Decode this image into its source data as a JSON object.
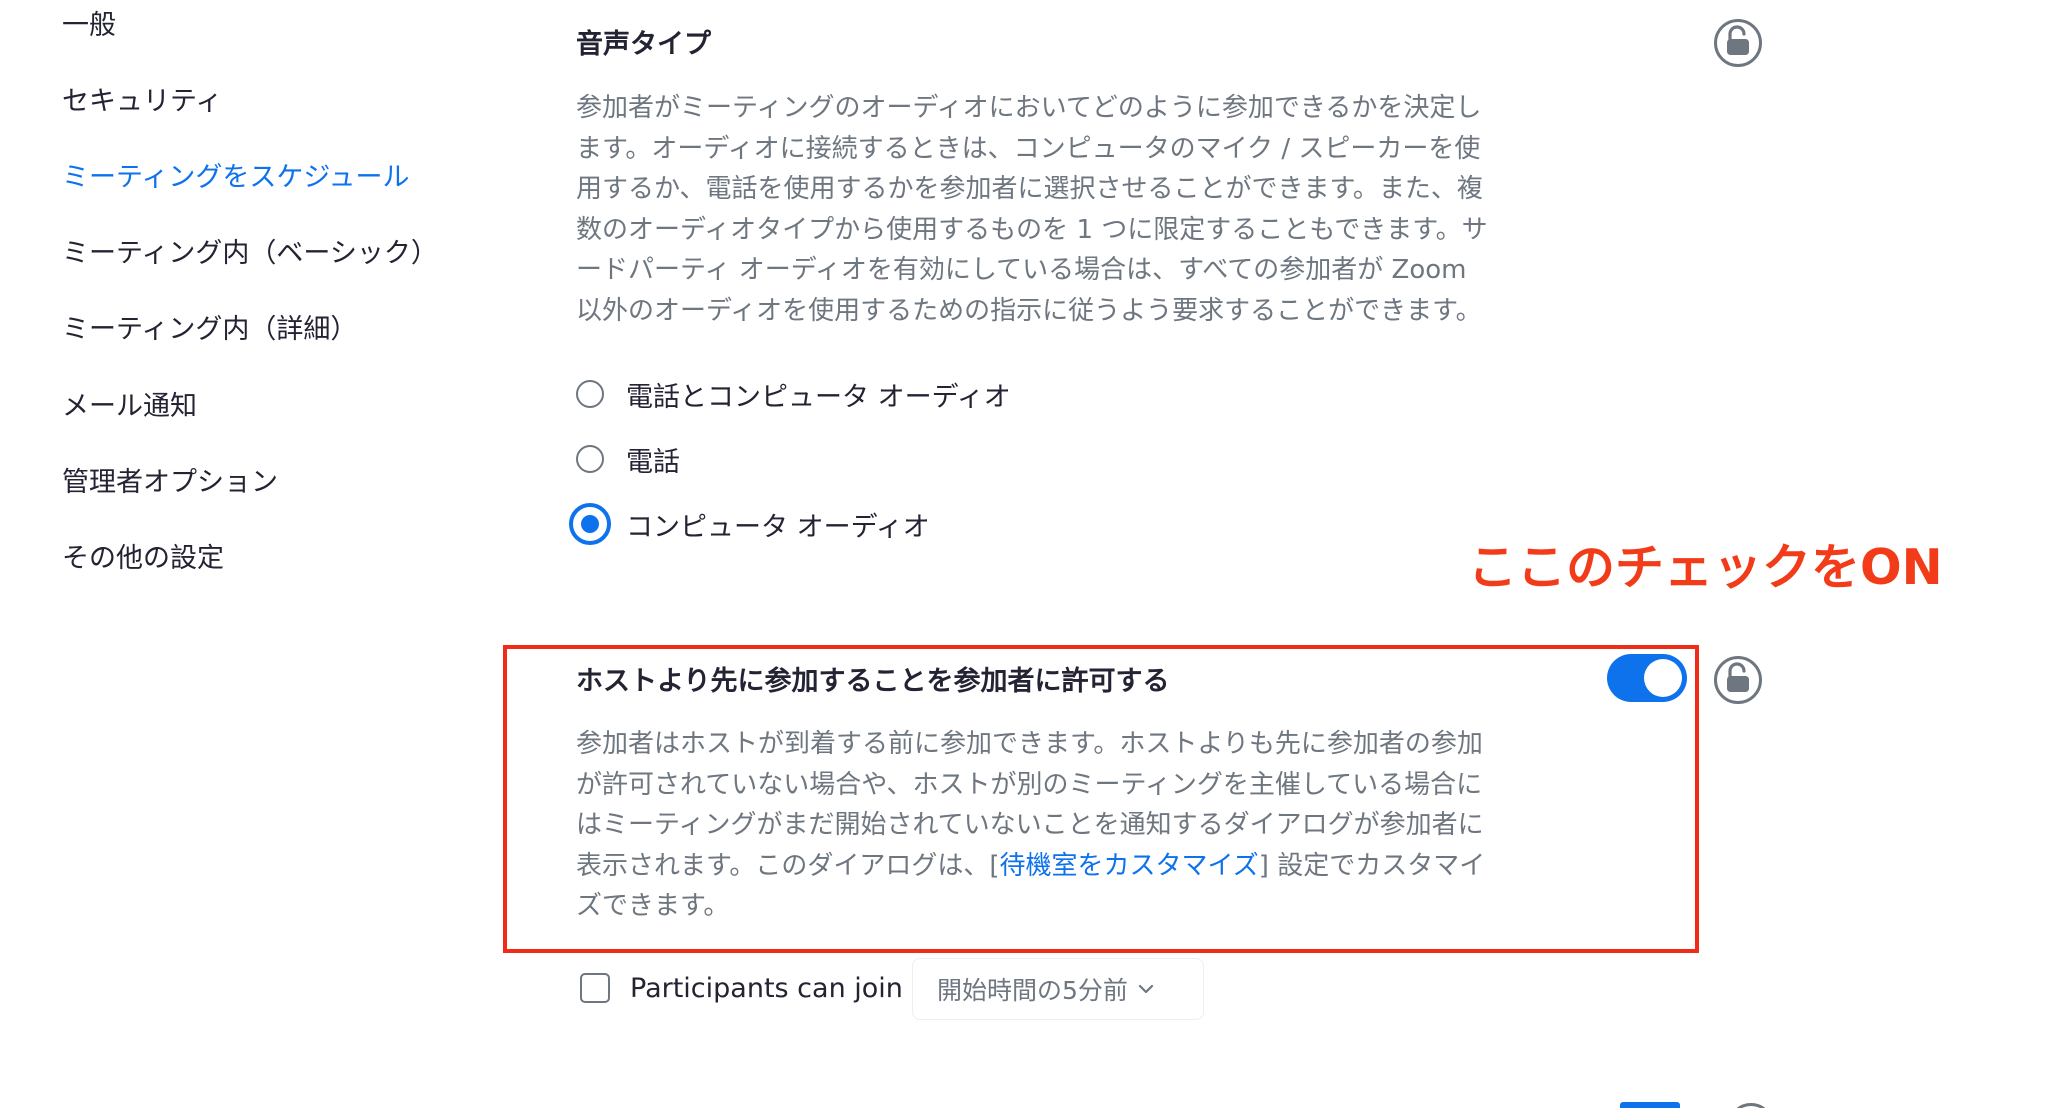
{
  "sidebar": {
    "items": [
      {
        "label": "一般"
      },
      {
        "label": "セキュリティ"
      },
      {
        "label": "ミーティングをスケジュール"
      },
      {
        "label": "ミーティング内（ベーシック）"
      },
      {
        "label": "ミーティング内（詳細）"
      },
      {
        "label": "メール通知"
      },
      {
        "label": "管理者オプション"
      },
      {
        "label": "その他の設定"
      }
    ],
    "active_index": 2
  },
  "audio_type": {
    "title": "音声タイプ",
    "description_lines": [
      "参加者がミーティングのオーディオにおいてどのように参加できるかを決定し",
      "ます。オーディオに接続するときは、コンピュータのマイク / スピーカーを使",
      "用するか、電話を使用するかを参加者に選択させることができます。また、複",
      "数のオーディオタイプから使用するものを 1 つに限定することもできます。サ",
      "ードパーティ オーディオを有効にしている場合は、すべての参加者が Zoom",
      "以外のオーディオを使用するための指示に従うよう要求することができます。"
    ],
    "options": [
      {
        "label": "電話とコンピュータ オーディオ",
        "selected": false
      },
      {
        "label": "電話",
        "selected": false
      },
      {
        "label": "コンピュータ オーディオ",
        "selected": true
      }
    ]
  },
  "annotation": {
    "text": "ここのチェックをON",
    "color": "#f23c19"
  },
  "join_before_host": {
    "title": "ホストより先に参加することを参加者に許可する",
    "enabled": true,
    "description_lines": [
      "参加者はホストが到着する前に参加できます。ホストよりも先に参加者の参加",
      "が許可されていない場合や、ホストが別のミーティングを主催している場合に",
      "はミーティングがまだ開始されていないことを通知するダイアログが参加者に"
    ],
    "desc_line4_prefix": "表示されます。このダイアログは、[",
    "desc_line4_link": "待機室をカスタマイズ",
    "desc_line4_suffix": "] 設定でカスタマイ",
    "desc_line5": "ズできます。",
    "participants_can_join_label": "Participants can join",
    "participants_can_join_checked": false,
    "time_select_value": "開始時間の5分前"
  },
  "colors": {
    "accent": "#0e72ed",
    "text": "#232333",
    "muted": "#6e7680",
    "highlight_box": "#ee2c17"
  },
  "icons": {
    "lock": "unlocked-padlock-icon",
    "chevron": "chevron-down-icon"
  }
}
